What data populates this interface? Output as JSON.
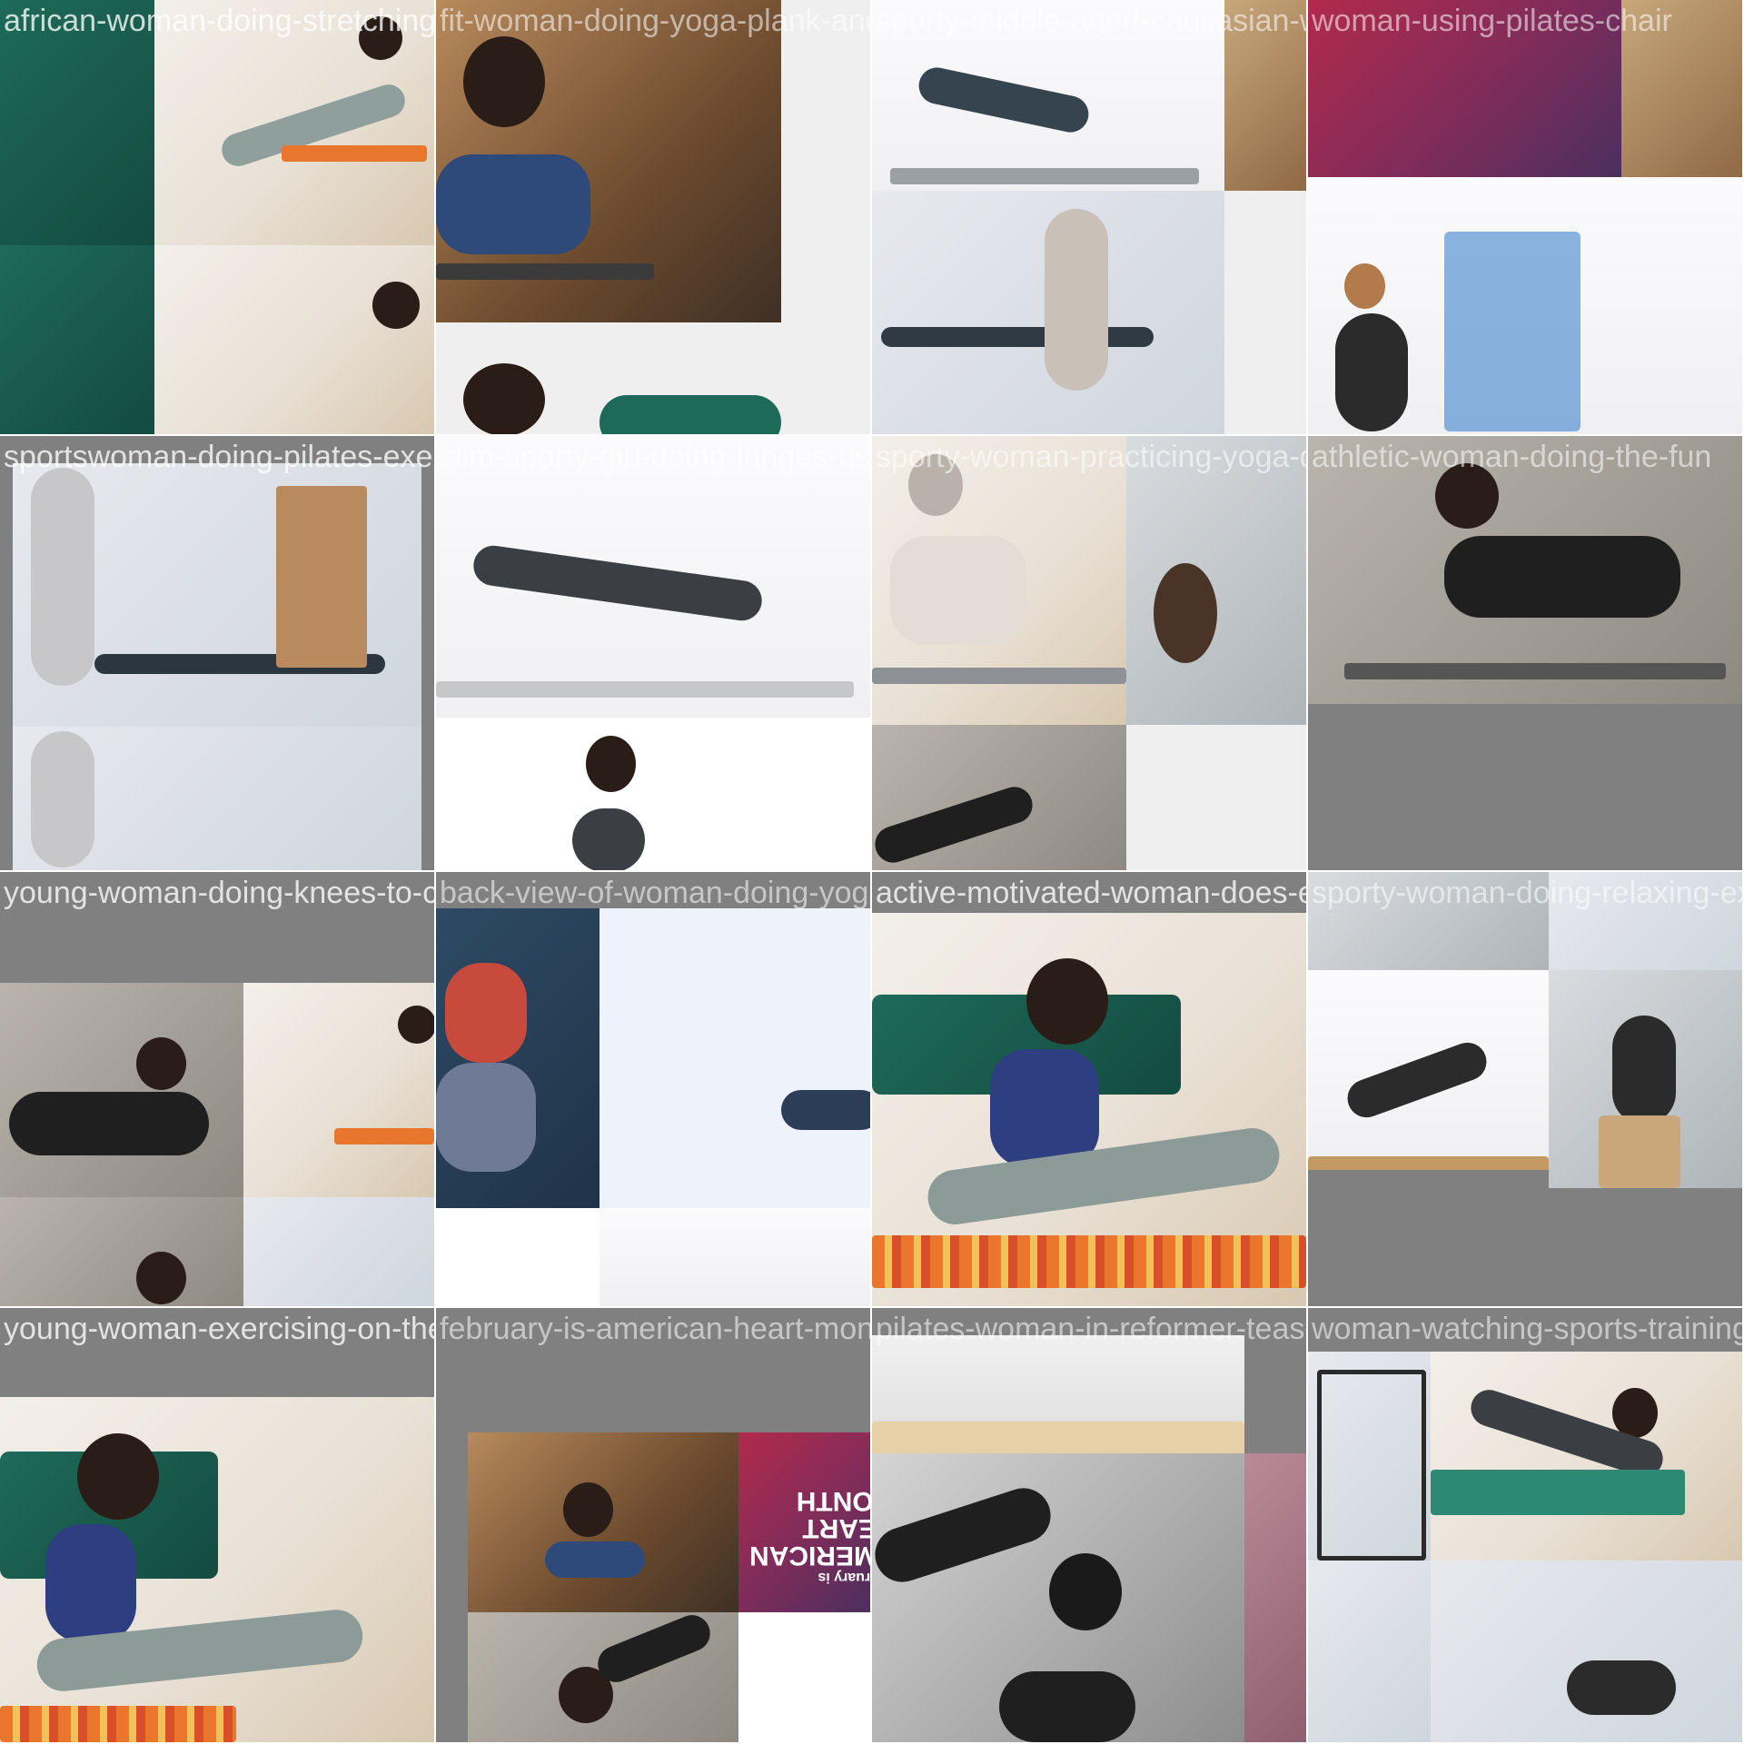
{
  "tiles": [
    {
      "caption": "african-woman-doing-stretching-at-home",
      "thumbs": [
        "african-woman-stretching",
        "african-woman-stretching-crop"
      ]
    },
    {
      "caption": "fit-woman-doing-yoga-plank-and-drinking",
      "thumbs": [
        "woman-yoga-plank",
        "african-woman-on-sofa"
      ]
    },
    {
      "caption": "sporty-middle-aged-caucasian-woman-doing",
      "thumbs": [
        "woman-lunge-dumbbells",
        "pilates-reformer-assist"
      ]
    },
    {
      "caption": "woman-using-pilates-chair",
      "thumbs": [
        "american-heart-month",
        "pilates-tower-stretch"
      ]
    },
    {
      "caption": "sportswoman-doing-pilates-exercises-with",
      "thumbs": [
        "reformer-assist",
        "reformer-assist-crop"
      ]
    },
    {
      "caption": "slim-sporty-girl-doing-lunges-using-dumb",
      "thumbs": [
        "lunge-dumbbells",
        "woman-ponytail-profile"
      ]
    },
    {
      "caption": "sporty-woman-practicing-yoga-doing-the",
      "thumbs": [
        "gray-hair-pushup",
        "woman-lying-stretch"
      ]
    },
    {
      "caption": "athletic-woman-doing-the-fun",
      "thumbs": [
        "woman-rolling-like-a-ball"
      ]
    },
    {
      "caption": "young-woman-doing-knees-to-chest-exercise",
      "thumbs": [
        "knees-to-chest",
        "african-woman-stretching-small"
      ]
    },
    {
      "caption": "back-view-of-woman-doing-yoga.jpg",
      "thumbs": [
        "back-view-squat",
        "lunge-bright"
      ]
    },
    {
      "caption": "active-motivated-woman-does-exercises",
      "thumbs": [
        "african-woman-stretch-large"
      ]
    },
    {
      "caption": "sporty-woman-doing-relaxing-exercises",
      "thumbs": [
        "tower-teaser",
        "pilates-chair-band"
      ]
    },
    {
      "caption": "young-woman-exercising-on-the-floor-pilates",
      "thumbs": [
        "african-woman-stretch-floor"
      ]
    },
    {
      "caption": "february-is-american-heart-month",
      "thumbs": [
        "woman-yoga-plank-shelf",
        "woman-rolling-floor"
      ],
      "heart_lines": [
        "February is",
        "AMERICAN",
        "HEART",
        "MONTH"
      ]
    },
    {
      "caption": "pilates-woman-in-reformer-teaser-exercise",
      "thumbs": [
        "reformer-teaser-bw"
      ]
    },
    {
      "caption": "woman-watching-sports-training",
      "thumbs": [
        "woman-plank-laptop",
        "tower-teaser-gym"
      ]
    }
  ],
  "colors": {
    "background": "#808080",
    "caption": "#ffffff"
  }
}
